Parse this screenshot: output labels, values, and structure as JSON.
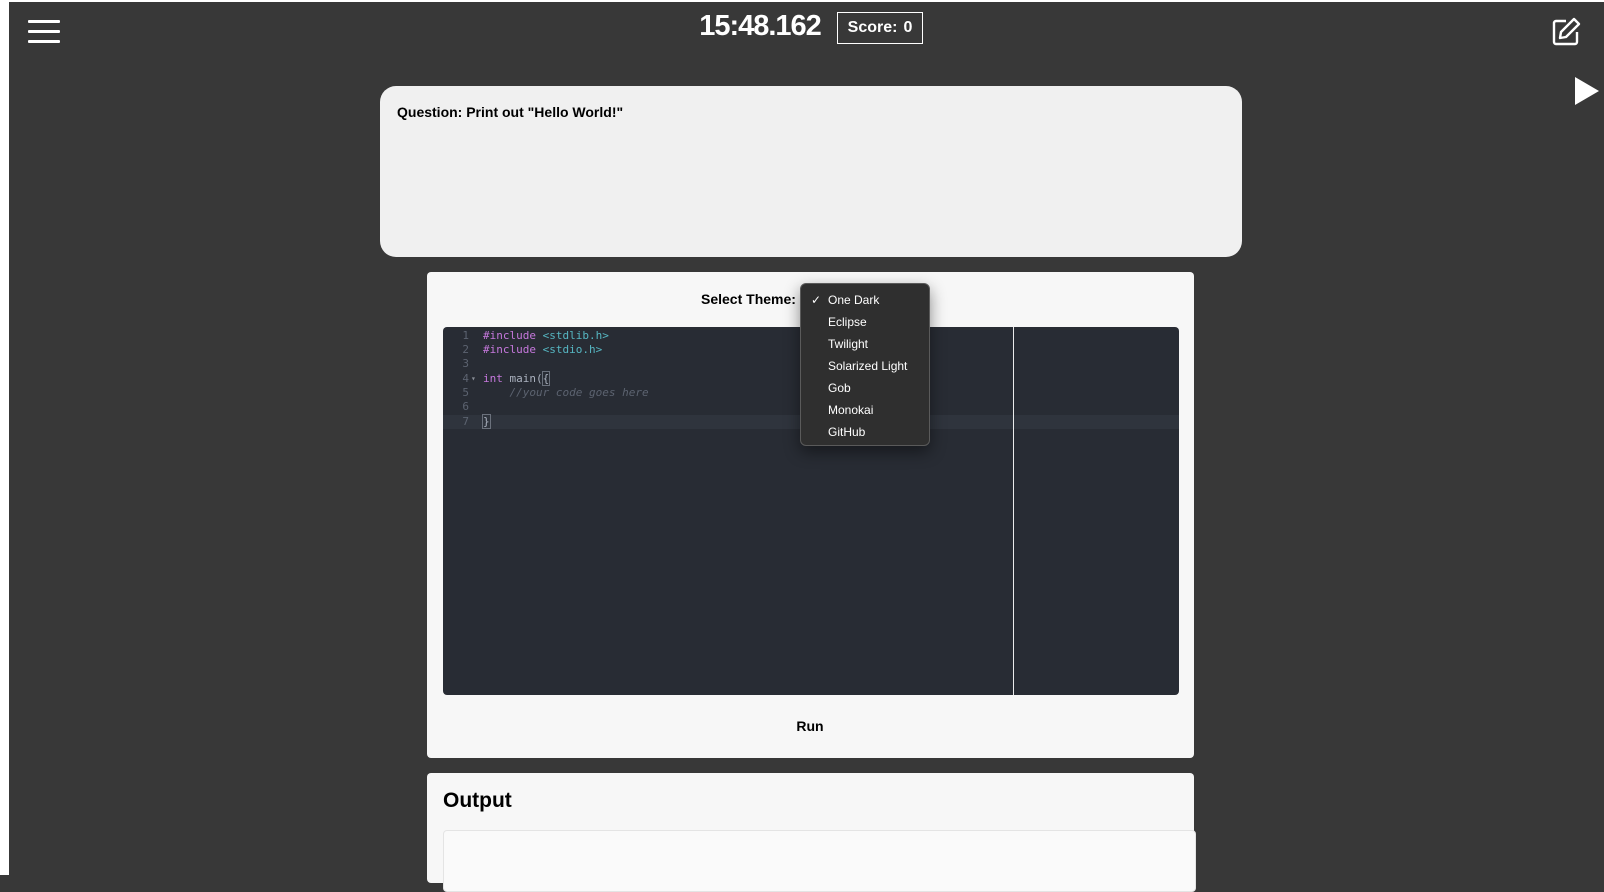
{
  "header": {
    "timer": "15:48.162",
    "score_label": "Score:",
    "score_value": "0"
  },
  "icons": {
    "menu": "hamburger-menu-icon",
    "edit": "edit-square-icon",
    "play": "play-icon"
  },
  "question": {
    "text": "Question: Print out \"Hello World!\""
  },
  "editor": {
    "theme_label": "Select Theme:",
    "lines": [
      {
        "num": "1",
        "text": "#include <stdlib.h>"
      },
      {
        "num": "2",
        "text": "#include <stdio.h>"
      },
      {
        "num": "3",
        "text": ""
      },
      {
        "num": "4",
        "text": "int main(){"
      },
      {
        "num": "5",
        "text": "    //your code goes here"
      },
      {
        "num": "6",
        "text": ""
      },
      {
        "num": "7",
        "text": "}"
      }
    ],
    "run_label": "Run"
  },
  "theme_dropdown": {
    "selected": "One Dark",
    "options": [
      "One Dark",
      "Eclipse",
      "Twilight",
      "Solarized Light",
      "Gob",
      "Monokai",
      "GitHub"
    ]
  },
  "output": {
    "title": "Output"
  },
  "colors": {
    "page_bg": "#383838",
    "editor_bg": "#282c34",
    "card_bg": "#f7f7f7",
    "keyword": "#c678dd",
    "header_include": "#56b6c2",
    "comment": "#5c6370"
  }
}
